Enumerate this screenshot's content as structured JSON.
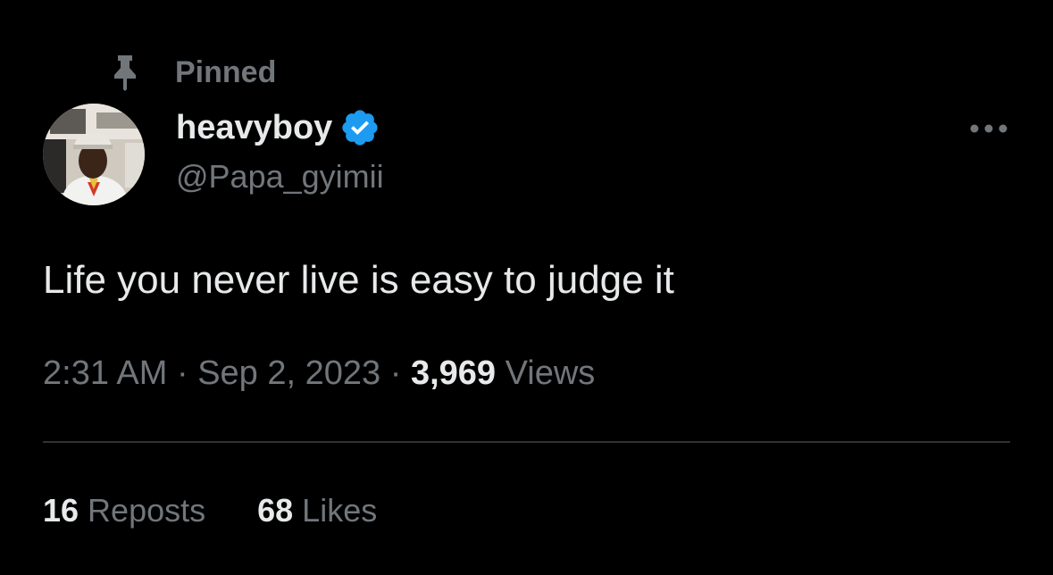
{
  "pinned": {
    "label": "Pinned",
    "icon": "pin-icon"
  },
  "author": {
    "display_name": "heavyboy",
    "handle": "@Papa_gyimii",
    "verified": true,
    "verified_color": "#1d9bf0"
  },
  "tweet": {
    "text": "Life you never live is easy to judge it"
  },
  "meta": {
    "time": "2:31 AM",
    "separator_1": " · ",
    "date": "Sep 2, 2023",
    "separator_2": " · ",
    "views_count": "3,969",
    "views_label": "Views"
  },
  "stats": {
    "reposts_count": "16",
    "reposts_label": "Reposts",
    "likes_count": "68",
    "likes_label": "Likes"
  },
  "colors": {
    "background": "#000000",
    "primary_text": "#e7e9ea",
    "secondary_text": "#71767b",
    "divider": "#2f3336",
    "verified": "#1d9bf0"
  }
}
